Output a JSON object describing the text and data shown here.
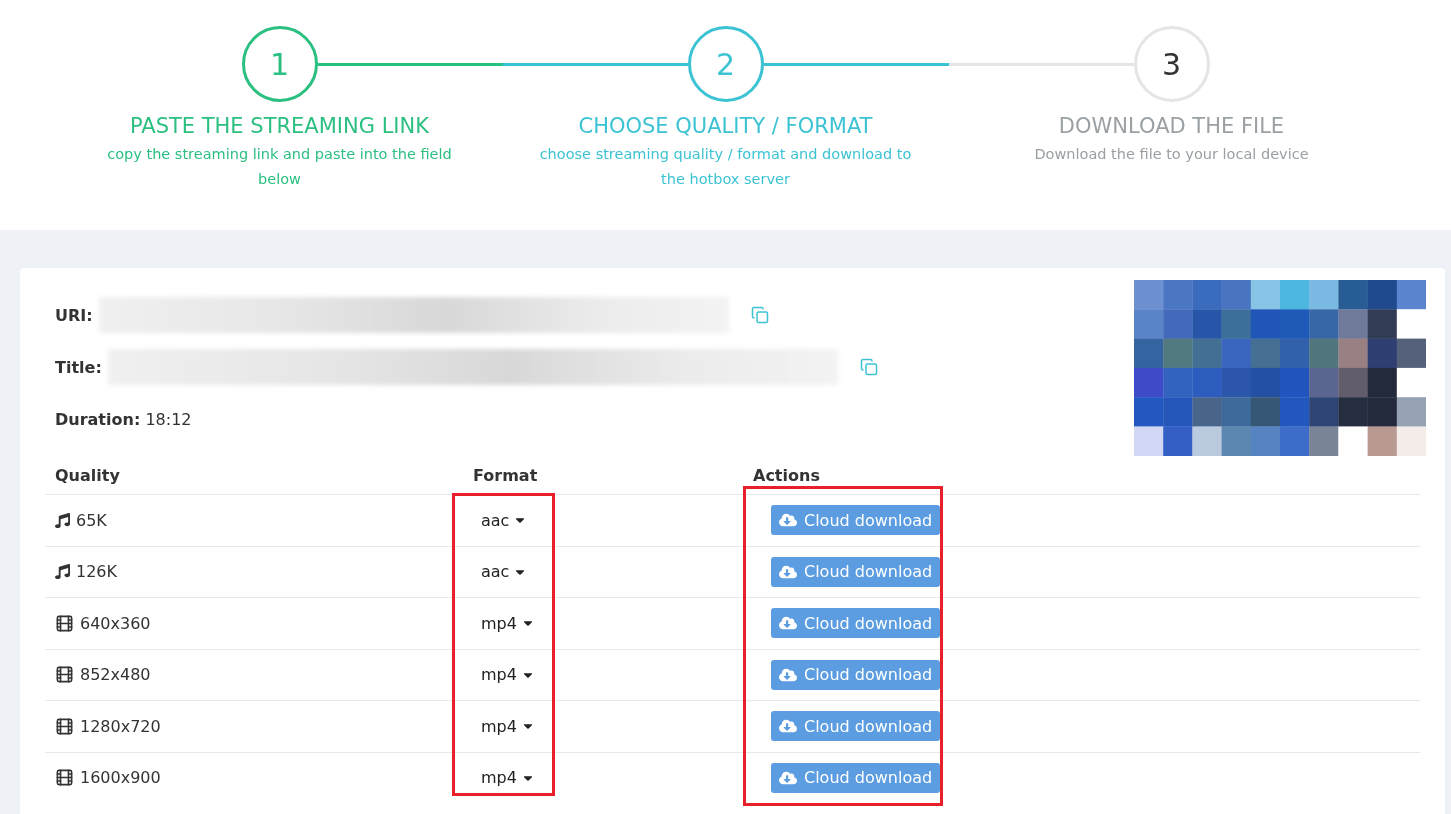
{
  "steps": [
    {
      "number": "1",
      "title": "PASTE THE STREAMING LINK",
      "subtitle": "copy the streaming link and paste into the field below",
      "done": true,
      "selected": false
    },
    {
      "number": "2",
      "title": "CHOOSE QUALITY / FORMAT",
      "subtitle": "choose streaming quality / format and download to the hotbox server",
      "done": false,
      "selected": true
    },
    {
      "number": "3",
      "title": "DOWNLOAD THE FILE",
      "subtitle": "Download the file to your local device",
      "done": false,
      "selected": false
    }
  ],
  "details": {
    "uri_label": "URI:",
    "title_label": "Title:",
    "duration_label": "Duration:",
    "duration": "18:12"
  },
  "table": {
    "columns": [
      {
        "label": "Quality"
      },
      {
        "label": "Format"
      },
      {
        "label": "Actions"
      }
    ],
    "highlight_frames": [
      {
        "kind": "frame"
      },
      {
        "kind": "frame"
      }
    ],
    "rows": [
      {
        "kind": "audio",
        "quality": "65K",
        "format": "aac",
        "action": "Cloud download"
      },
      {
        "kind": "audio",
        "quality": "126K",
        "format": "aac",
        "action": "Cloud download"
      },
      {
        "kind": "video",
        "quality": "640x360",
        "format": "mp4",
        "action": "Cloud download"
      },
      {
        "kind": "video",
        "quality": "852x480",
        "format": "mp4",
        "action": "Cloud download"
      },
      {
        "kind": "video",
        "quality": "1280x720",
        "format": "mp4",
        "action": "Cloud download"
      },
      {
        "kind": "video",
        "quality": "1600x900",
        "format": "mp4",
        "action": "Cloud download"
      }
    ]
  }
}
